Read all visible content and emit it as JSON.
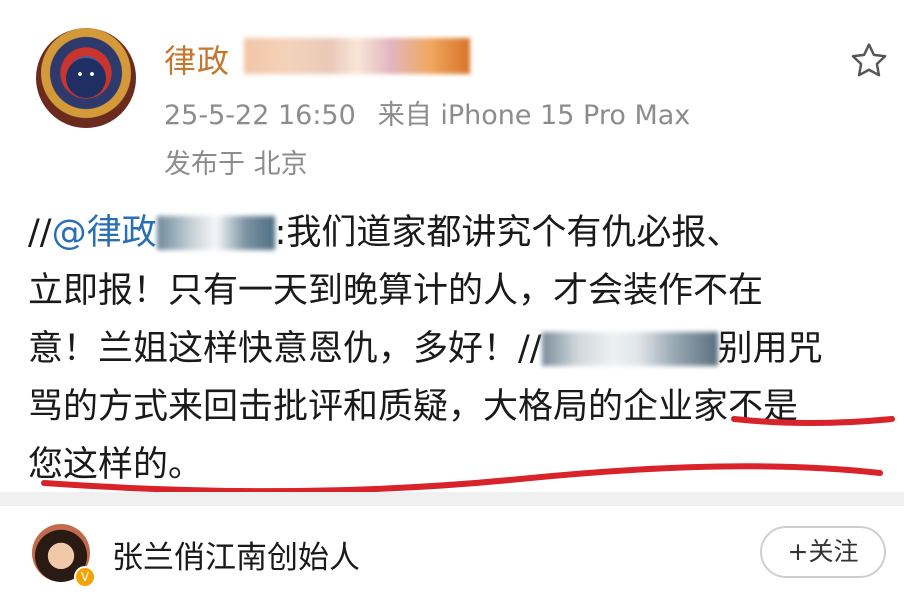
{
  "post": {
    "author_name_visible": "律政",
    "timestamp": "25-5-22 16:50",
    "source": "来自 iPhone 15 Pro Max",
    "location": "发布于 北京",
    "content": {
      "line1_prefix": "//",
      "line1_mention": "@律政",
      "line1_text": ":我们道家都讲究个有仇必报、",
      "line2": "立即报！只有一天到晚算计的人，才会装作不在",
      "line3_text": "意！兰姐这样快意恩仇，多好！//",
      "line3_tail": "别用咒",
      "line4": "骂的方式来回击批评和质疑，大格局的企业家不是",
      "line5": "您这样的。"
    },
    "icons": {
      "favorite": "star-outline-icon",
      "verified": "verified-badge-icon"
    },
    "colors": {
      "author": "#c4772e",
      "mention": "#2a6fb5",
      "underline": "#d8232a",
      "meta": "#8c8c8c"
    }
  },
  "footer": {
    "name": "张兰俏江南创始人",
    "follow_label": "+关注"
  }
}
